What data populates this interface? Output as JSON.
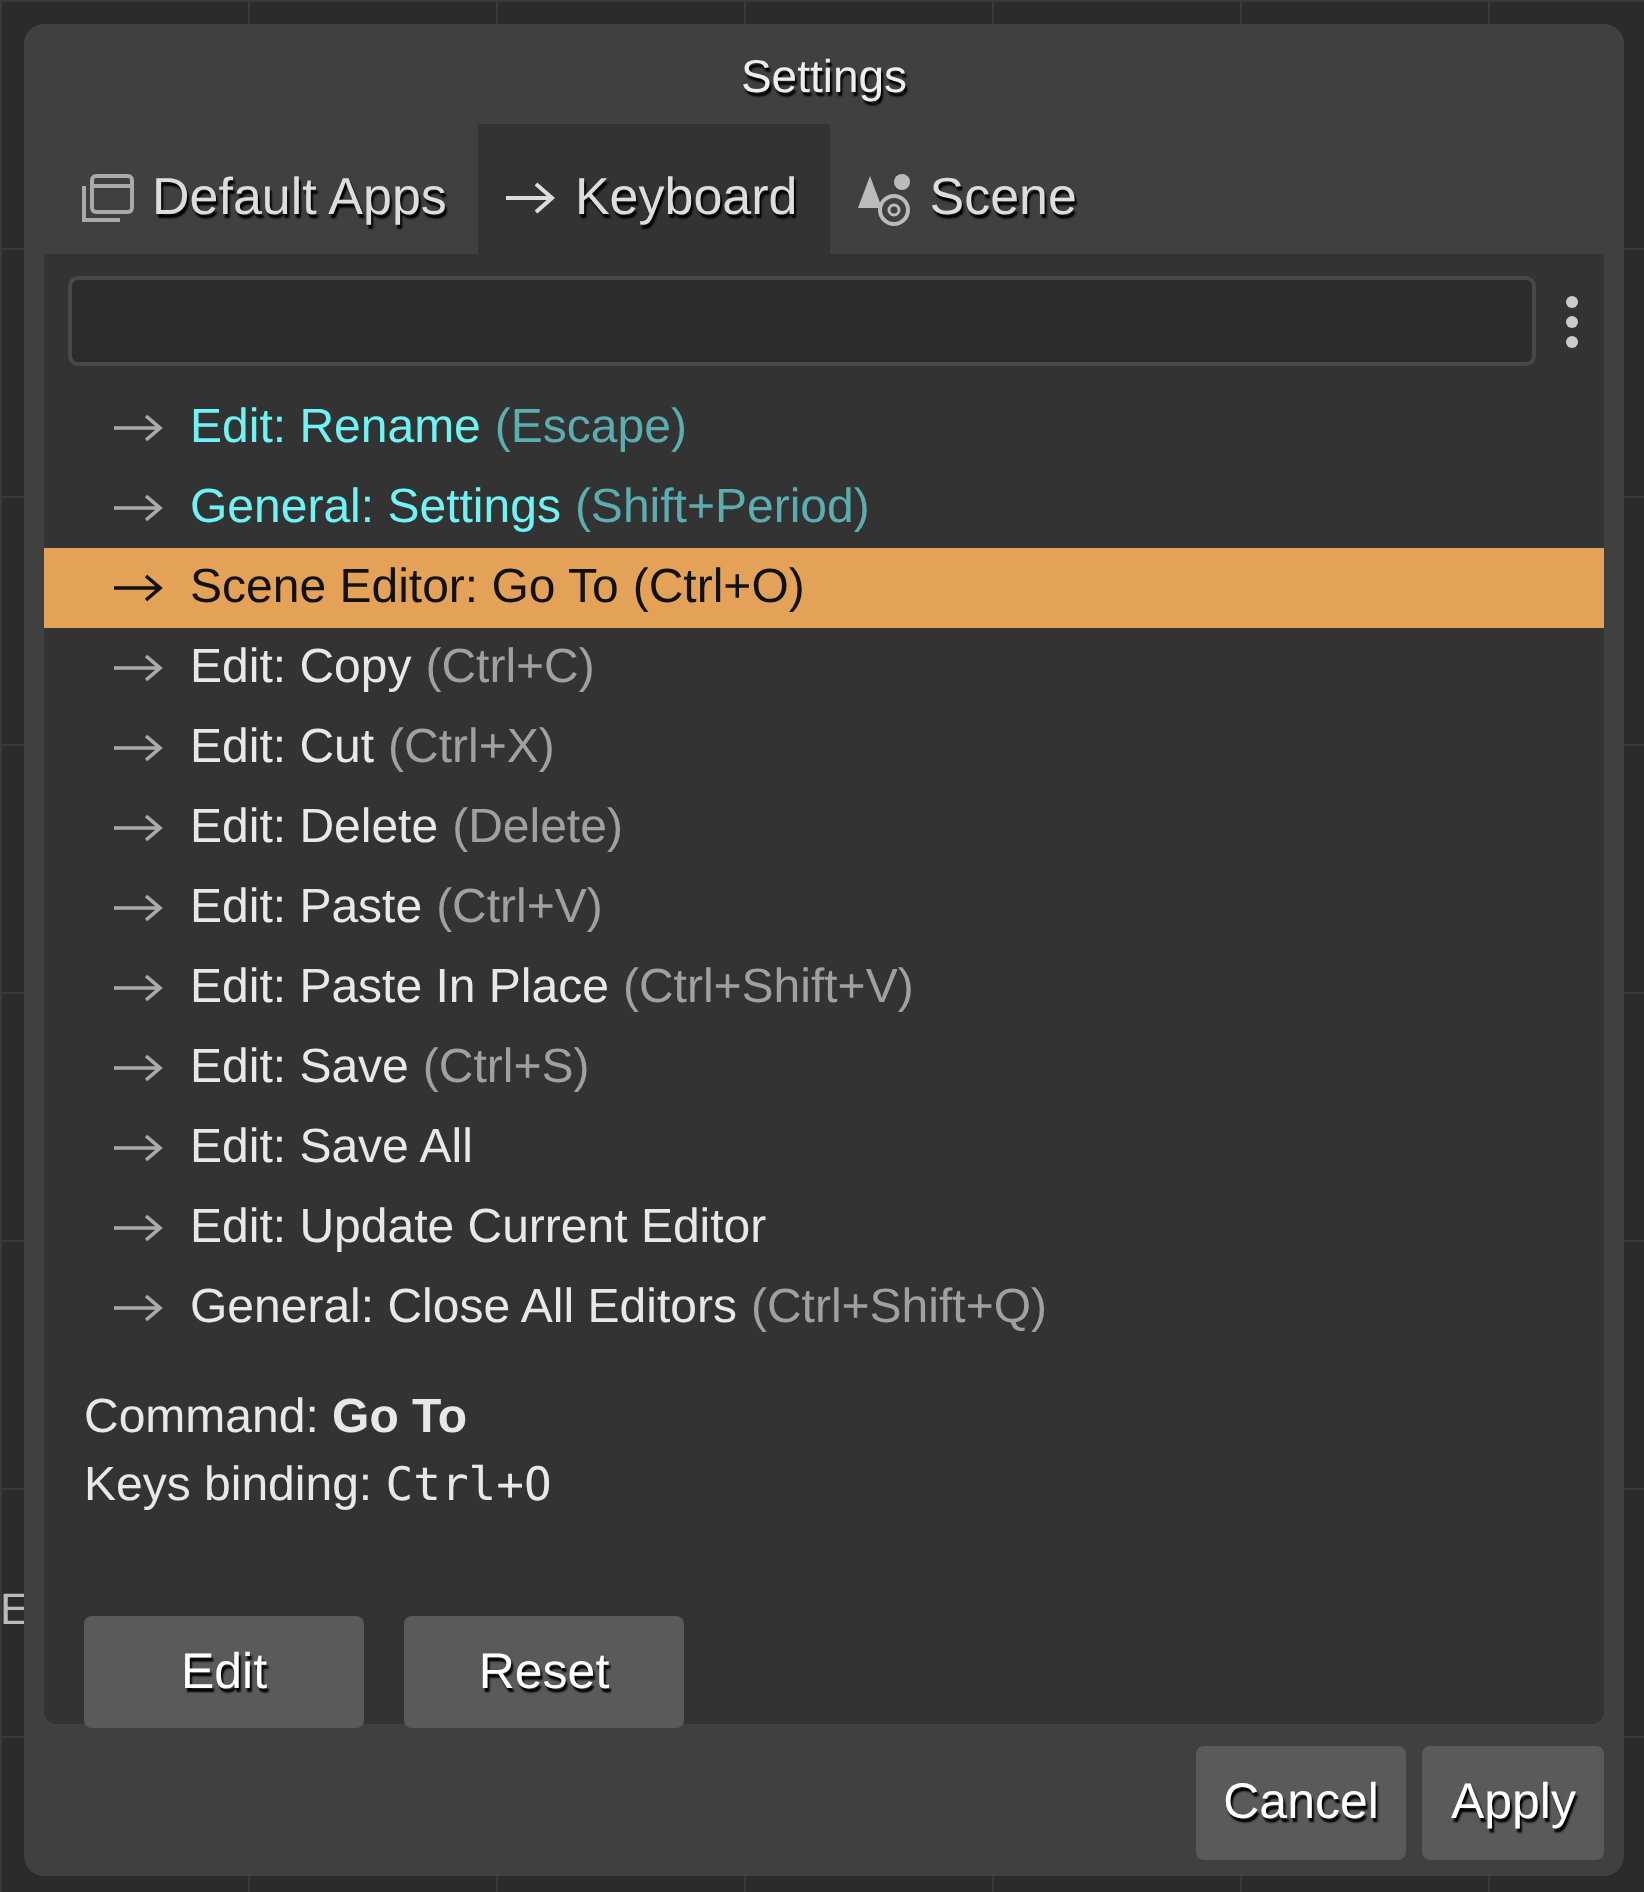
{
  "background": {
    "texts": [
      "E"
    ]
  },
  "window": {
    "title": "Settings"
  },
  "tabs": [
    {
      "label": "Default Apps",
      "kind": "window",
      "selected": false
    },
    {
      "label": "Keyboard",
      "kind": "arrow",
      "selected": true
    },
    {
      "label": "Scene",
      "kind": "shapes",
      "selected": false
    }
  ],
  "commands": [
    {
      "command": "Edit: Rename",
      "keys": "(Escape)",
      "modified": true,
      "selected": false
    },
    {
      "command": "General: Settings",
      "keys": "(Shift+Period)",
      "modified": true,
      "selected": false
    },
    {
      "command": "Scene Editor: Go To",
      "keys": "(Ctrl+O)",
      "modified": false,
      "selected": true
    },
    {
      "command": "Edit: Copy",
      "keys": "(Ctrl+C)",
      "modified": false,
      "selected": false
    },
    {
      "command": "Edit: Cut",
      "keys": "(Ctrl+X)",
      "modified": false,
      "selected": false
    },
    {
      "command": "Edit: Delete",
      "keys": "(Delete)",
      "modified": false,
      "selected": false
    },
    {
      "command": "Edit: Paste",
      "keys": "(Ctrl+V)",
      "modified": false,
      "selected": false
    },
    {
      "command": "Edit: Paste In Place",
      "keys": "(Ctrl+Shift+V)",
      "modified": false,
      "selected": false
    },
    {
      "command": "Edit: Save",
      "keys": "(Ctrl+S)",
      "modified": false,
      "selected": false
    },
    {
      "command": "Edit: Save All",
      "modified": false,
      "selected": false
    },
    {
      "command": "Edit: Update Current Editor",
      "modified": false,
      "selected": false
    },
    {
      "command": "General: Close All Editors",
      "keys": "(Ctrl+Shift+Q)",
      "modified": false,
      "selected": false
    }
  ],
  "details": {
    "command_label": "Command:",
    "command_value": "Go To",
    "binding_label": "Keys binding:",
    "binding_value": "Ctrl+O"
  },
  "panel_buttons": [
    "Edit",
    "Reset"
  ],
  "dialog_buttons": [
    "Cancel",
    "Apply"
  ]
}
